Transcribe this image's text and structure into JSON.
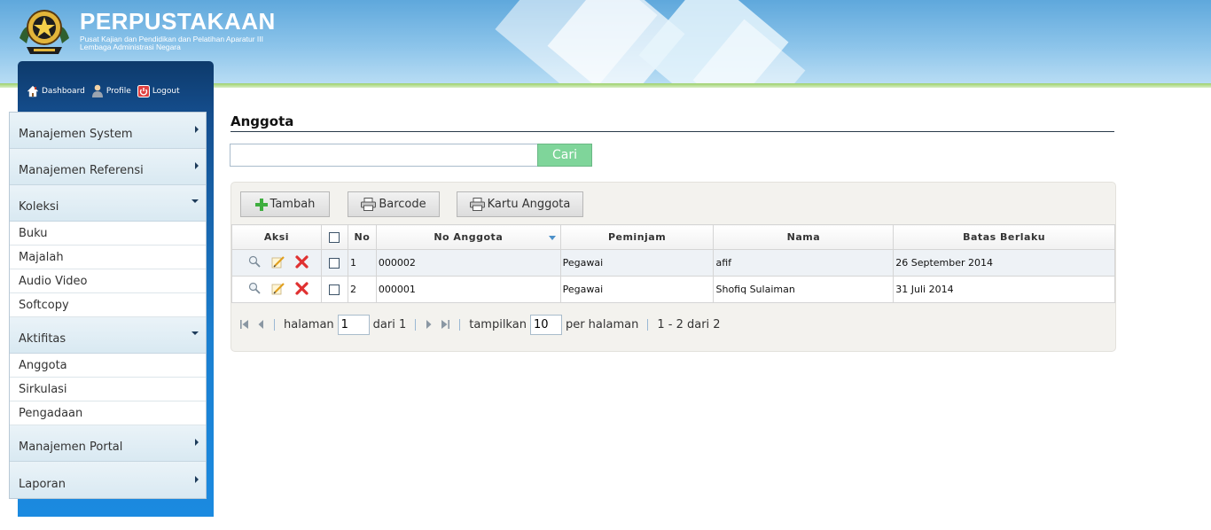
{
  "header": {
    "title": "PERPUSTAKAAN",
    "subtitle1": "Pusat Kajian dan Pendidikan dan Pelatihan Aparatur III",
    "subtitle2": "Lembaga Administrasi Negara",
    "logo_icon": "garuda-emblem-icon"
  },
  "toplinks": {
    "dashboard": "Dashboard",
    "profile": "Profile",
    "logout": "Logout"
  },
  "menu": {
    "sections": [
      {
        "label": "Manajemen System",
        "state": "collapsed"
      },
      {
        "label": "Manajemen Referensi",
        "state": "collapsed"
      },
      {
        "label": "Koleksi",
        "state": "expanded",
        "items": [
          "Buku",
          "Majalah",
          "Audio Video",
          "Softcopy"
        ]
      },
      {
        "label": "Aktifitas",
        "state": "expanded",
        "items": [
          "Anggota",
          "Sirkulasi",
          "Pengadaan"
        ]
      },
      {
        "label": "Manajemen Portal",
        "state": "collapsed"
      },
      {
        "label": "Laporan",
        "state": "collapsed"
      }
    ]
  },
  "main": {
    "page_title": "Anggota",
    "search": {
      "value": "",
      "button": "Cari"
    },
    "toolbar": {
      "add": "Tambah",
      "barcode": "Barcode",
      "card": "Kartu Anggota"
    },
    "table": {
      "columns": [
        "Aksi",
        "No",
        "No Anggota",
        "Peminjam",
        "Nama",
        "Batas Berlaku"
      ],
      "rows": [
        {
          "no": "1",
          "no_anggota": "000002",
          "peminjam": "Pegawai",
          "nama": "afif",
          "batas_berlaku": "26 September 2014"
        },
        {
          "no": "2",
          "no_anggota": "000001",
          "peminjam": "Pegawai",
          "nama": "Shofiq Sulaiman",
          "batas_berlaku": "31 Juli 2014"
        }
      ]
    },
    "pager": {
      "page_label": "halaman",
      "page_value": "1",
      "of_label": "dari 1",
      "show_label": "tampilkan",
      "per_page_value": "10",
      "per_page_label": "per halaman",
      "summary": "1 - 2 dari 2"
    }
  },
  "colors": {
    "header_blue": "#5fa8dc",
    "sidebar_blue": "#1a7fd0",
    "search_button_green": "#7fd59a",
    "delete_red": "#e03131"
  }
}
